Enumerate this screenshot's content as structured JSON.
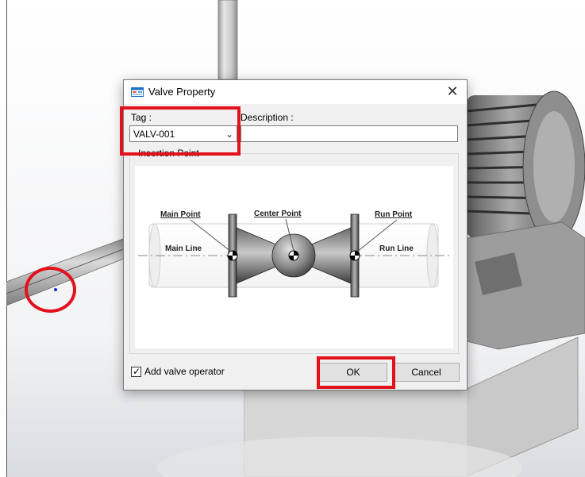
{
  "dialog": {
    "title": "Valve Property",
    "close_glyph": "✕",
    "tag_label": "Tag :",
    "tag_value": "VALV-001",
    "description_label": "Description :",
    "description_value": "",
    "insertion_point_label": "Insertion Point",
    "checkbox_label": "Add valve operator",
    "checkbox_checked": true,
    "ok_label": "OK",
    "cancel_label": "Cancel"
  },
  "diagram": {
    "main_point": "Main Point",
    "center_point": "Center Point",
    "run_point": "Run Point",
    "main_line": "Main Line",
    "run_line": "Run Line"
  },
  "colors": {
    "highlight": "#e3111b",
    "dialog_bg": "#f0f0f0",
    "titlebar_bg": "#ffffff",
    "button_bg": "#e1e1e1"
  },
  "icons": {
    "title_icon": "window-form-icon",
    "close_icon": "close-icon",
    "dropdown_icon": "chevron-down-icon",
    "checkbox_icon": "checkmark-icon"
  }
}
